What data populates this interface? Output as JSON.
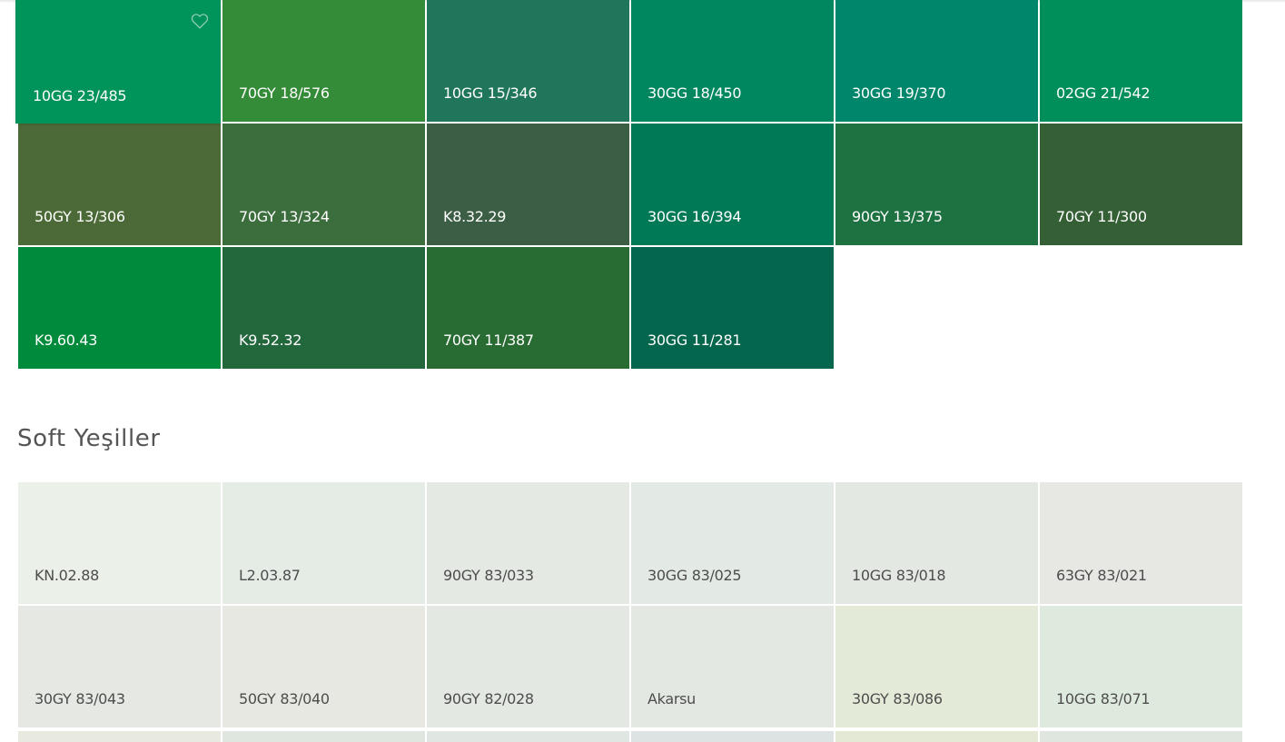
{
  "sections": [
    {
      "id": "dark",
      "title": "",
      "swatches": [
        {
          "code": "10GG 23/485",
          "color": "#00935a",
          "favorite": true
        },
        {
          "code": "70GY 18/576",
          "color": "#348b38"
        },
        {
          "code": "10GG 15/346",
          "color": "#20765a"
        },
        {
          "code": "30GG 18/450",
          "color": "#00875f"
        },
        {
          "code": "30GG 19/370",
          "color": "#00866a"
        },
        {
          "code": "02GG 21/542",
          "color": "#008e5a"
        },
        {
          "code": "50GY 13/306",
          "color": "#4c6a37"
        },
        {
          "code": "70GY 13/324",
          "color": "#3c6d3d"
        },
        {
          "code": "K8.32.29",
          "color": "#3c5e45"
        },
        {
          "code": "30GG 16/394",
          "color": "#007a56"
        },
        {
          "code": "90GY 13/375",
          "color": "#1e7141"
        },
        {
          "code": "70GY 11/300",
          "color": "#355f35"
        },
        {
          "code": "K9.60.43",
          "color": "#008a3c"
        },
        {
          "code": "K9.52.32",
          "color": "#23673c"
        },
        {
          "code": "70GY 11/387",
          "color": "#286c33"
        },
        {
          "code": "30GG 11/281",
          "color": "#03664d"
        }
      ]
    },
    {
      "id": "soft",
      "title": "Soft Yeşiller",
      "swatches": [
        {
          "code": "KN.02.88",
          "color": "#ebf0e8"
        },
        {
          "code": "L2.03.87",
          "color": "#e4ece5"
        },
        {
          "code": "90GY 83/033",
          "color": "#e4e9e3"
        },
        {
          "code": "30GG 83/025",
          "color": "#e3e9e4"
        },
        {
          "code": "10GG 83/018",
          "color": "#e4e8e3"
        },
        {
          "code": "63GY 83/021",
          "color": "#e7e8e3"
        },
        {
          "code": "30GY 83/043",
          "color": "#e6e9e3"
        },
        {
          "code": "50GY 83/040",
          "color": "#e6e8e1"
        },
        {
          "code": "90GY 82/028",
          "color": "#e3e8e2"
        },
        {
          "code": "Akarsu",
          "color": "#e3e8e2"
        },
        {
          "code": "30GY 83/086",
          "color": "#e4ead8"
        },
        {
          "code": "10GG 83/071",
          "color": "#dfeadf"
        }
      ],
      "peek_colors": [
        "#e8e9df",
        "#dfe5df",
        "#e0e6e2",
        "#dde3e2",
        "#e4e9d5",
        "#dfe6e0"
      ]
    }
  ],
  "icons": {
    "favorite": "heart-outline-icon"
  }
}
